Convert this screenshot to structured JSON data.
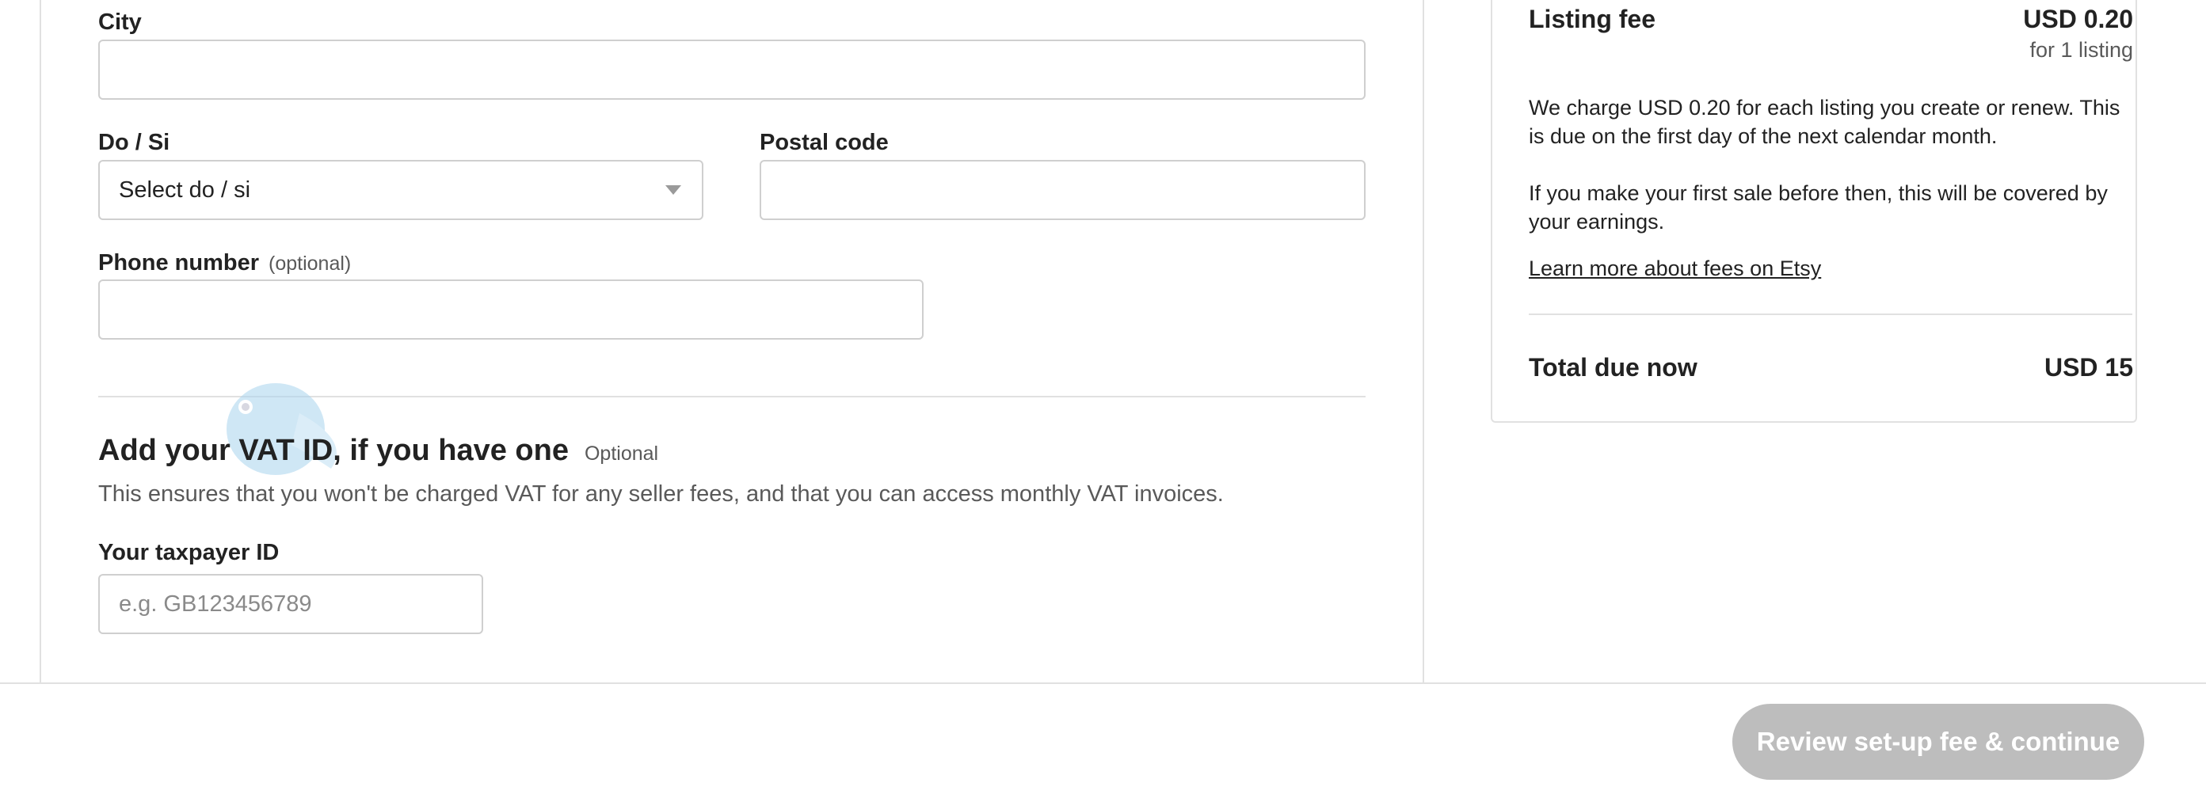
{
  "form": {
    "city": {
      "label": "City",
      "value": ""
    },
    "region": {
      "label": "Do / Si",
      "selected": "Select do / si"
    },
    "postal": {
      "label": "Postal code",
      "value": ""
    },
    "phone": {
      "label": "Phone number",
      "optional": "(optional)",
      "value": ""
    }
  },
  "vat": {
    "title": "Add your VAT ID, if you have one",
    "optional": "Optional",
    "description": "This ensures that you won't be charged VAT for any seller fees, and that you can access monthly VAT invoices.",
    "taxpayer_label": "Your taxpayer ID",
    "taxpayer_placeholder": "e.g. GB123456789"
  },
  "summary": {
    "fee_title": "Listing fee",
    "fee_amount": "USD 0.20",
    "fee_sub": "for 1 listing",
    "para1": "We charge USD 0.20 for each listing you create or renew. This is due on the first day of the next calendar month.",
    "para2": "If you make your first sale before then, this will be covered by your earnings.",
    "learn_more": "Learn more about fees on Etsy",
    "total_label": "Total due now",
    "total_amount": "USD 15"
  },
  "footer": {
    "cta_label": "Review set-up fee & continue"
  },
  "colors": {
    "cta_disabled": "#bdbdbd",
    "border": "#cfcfcf",
    "divider": "#e1e1e1"
  },
  "icons": {
    "dropdown": "caret-down-icon",
    "mascot": "bird-mascot-icon"
  }
}
